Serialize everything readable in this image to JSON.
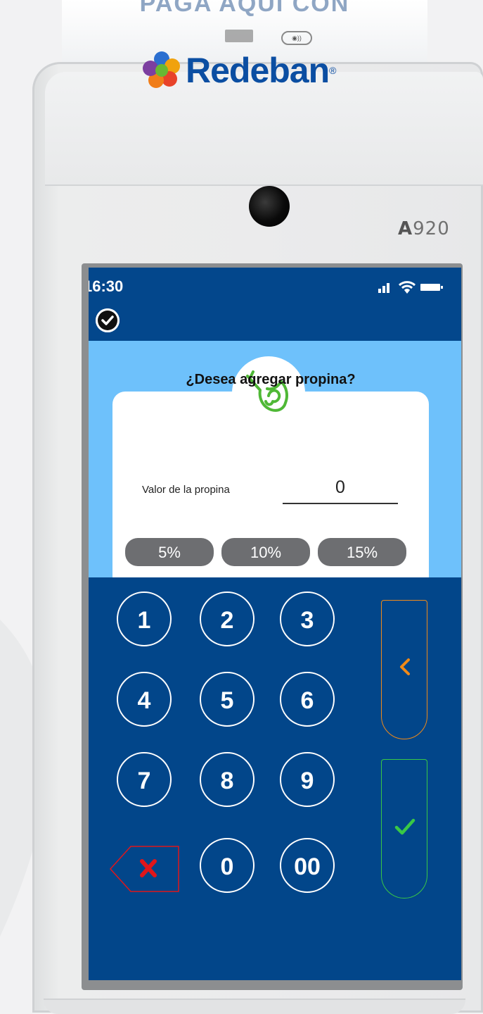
{
  "device": {
    "top_caption": "PAGA AQUI CON",
    "brand": "Redeban",
    "brand_mark": "®",
    "model_prefix": "A",
    "model_number": "920"
  },
  "statusbar": {
    "time": "16:30",
    "icons": [
      "signal-icon",
      "wifi-icon",
      "battery-icon"
    ]
  },
  "header": {
    "icons": [
      "check-circle-icon"
    ]
  },
  "tip_card": {
    "icon": "tip-hand-icon",
    "question": "¿Desea agregar propina?",
    "field_label": "Valor de la propina",
    "field_value": "0",
    "percent_options": [
      "5%",
      "10%",
      "15%"
    ]
  },
  "keypad": {
    "keys": [
      "1",
      "2",
      "3",
      "4",
      "5",
      "6",
      "7",
      "8",
      "9",
      "0",
      "00"
    ],
    "delete_icon": "x-icon",
    "back_icon": "chevron-left-icon",
    "confirm_icon": "check-icon"
  },
  "colors": {
    "screen_blue": "#02468a",
    "content_light_blue": "#6ec1fb",
    "percent_button": "#6d6e71",
    "back_orange": "#f08a18",
    "confirm_green": "#39c846",
    "delete_red": "#e0161b"
  }
}
